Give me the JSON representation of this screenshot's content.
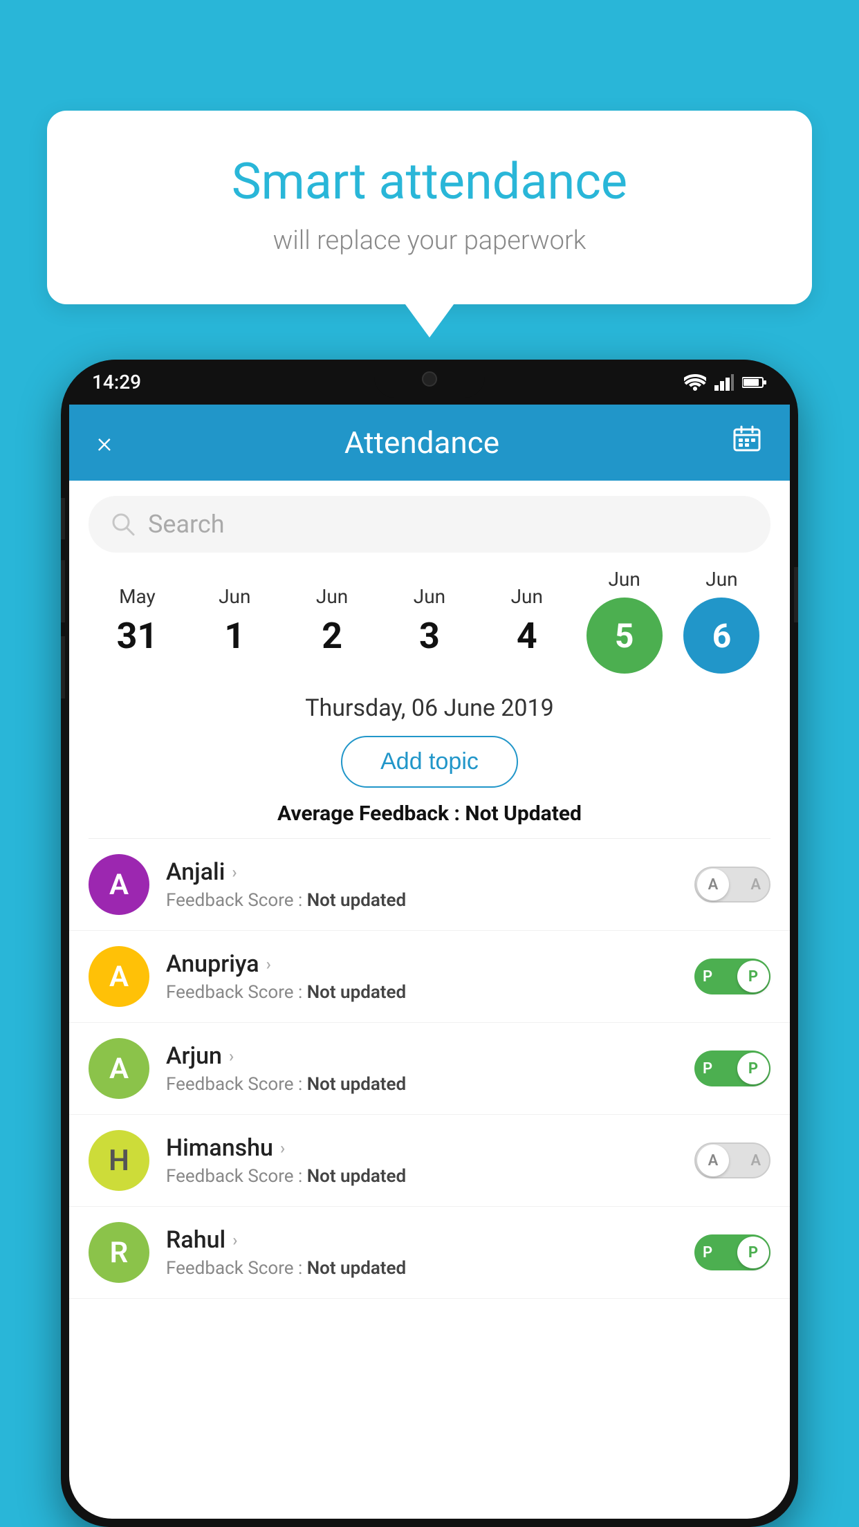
{
  "background_color": "#29B6D8",
  "bubble": {
    "title": "Smart attendance",
    "subtitle": "will replace your paperwork"
  },
  "status_bar": {
    "time": "14:29",
    "wifi_icon": "wifi",
    "signal_icon": "signal",
    "battery_icon": "battery"
  },
  "header": {
    "close_label": "×",
    "title": "Attendance",
    "calendar_icon": "calendar"
  },
  "search": {
    "placeholder": "Search"
  },
  "dates": [
    {
      "month": "May",
      "day": "31",
      "highlight": "none"
    },
    {
      "month": "Jun",
      "day": "1",
      "highlight": "none"
    },
    {
      "month": "Jun",
      "day": "2",
      "highlight": "none"
    },
    {
      "month": "Jun",
      "day": "3",
      "highlight": "none"
    },
    {
      "month": "Jun",
      "day": "4",
      "highlight": "none"
    },
    {
      "month": "Jun",
      "day": "5",
      "highlight": "green"
    },
    {
      "month": "Jun",
      "day": "6",
      "highlight": "blue"
    }
  ],
  "selected_date": "Thursday, 06 June 2019",
  "add_topic_label": "Add topic",
  "avg_feedback_label": "Average Feedback : ",
  "avg_feedback_value": "Not Updated",
  "students": [
    {
      "name": "Anjali",
      "avatar_letter": "A",
      "avatar_color": "purple",
      "feedback_label": "Feedback Score : ",
      "feedback_value": "Not updated",
      "toggle": "off",
      "toggle_letter": "A"
    },
    {
      "name": "Anupriya",
      "avatar_letter": "A",
      "avatar_color": "yellow",
      "feedback_label": "Feedback Score : ",
      "feedback_value": "Not updated",
      "toggle": "on",
      "toggle_letter": "P"
    },
    {
      "name": "Arjun",
      "avatar_letter": "A",
      "avatar_color": "green-light",
      "feedback_label": "Feedback Score : ",
      "feedback_value": "Not updated",
      "toggle": "on",
      "toggle_letter": "P"
    },
    {
      "name": "Himanshu",
      "avatar_letter": "H",
      "avatar_color": "lime",
      "feedback_label": "Feedback Score : ",
      "feedback_value": "Not updated",
      "toggle": "off",
      "toggle_letter": "A"
    },
    {
      "name": "Rahul",
      "avatar_letter": "R",
      "avatar_color": "green-light",
      "feedback_label": "Feedback Score : ",
      "feedback_value": "Not updated",
      "toggle": "on",
      "toggle_letter": "P"
    }
  ]
}
